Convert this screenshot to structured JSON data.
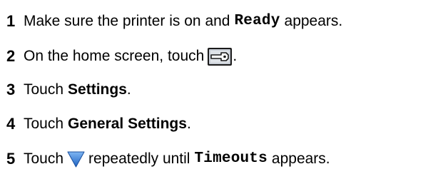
{
  "steps": [
    {
      "number": "1",
      "parts": [
        "Make sure the printer is on and",
        "Ready",
        "appears."
      ]
    },
    {
      "number": "2",
      "parts": [
        "On the home screen, touch",
        "."
      ],
      "icon": "settings-tool-icon"
    },
    {
      "number": "3",
      "parts": [
        "Touch",
        "Settings",
        "."
      ]
    },
    {
      "number": "4",
      "parts": [
        "Touch",
        "General Settings",
        "."
      ]
    },
    {
      "number": "5",
      "parts": [
        "Touch",
        "repeatedly until",
        "Timeouts",
        "appears."
      ],
      "icon": "down-arrow-icon"
    }
  ],
  "colors": {
    "text": "#000000",
    "arrow_blue": "#2a78d8",
    "icon_frame": "#1a1a1a",
    "icon_fill": "#c9ced6"
  }
}
